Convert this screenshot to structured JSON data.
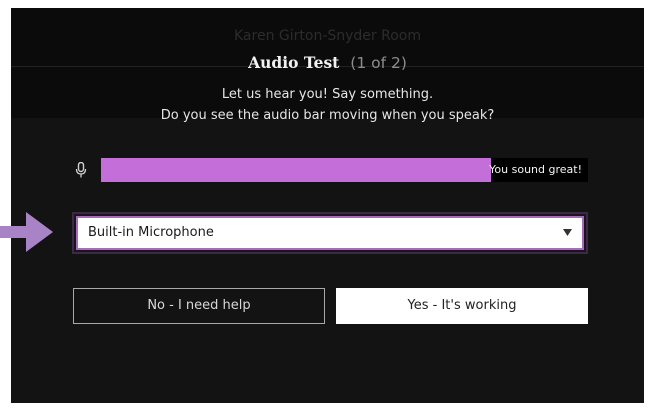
{
  "room": {
    "name": "Karen Girton-Snyder Room"
  },
  "dialog": {
    "title": "Audio Test",
    "step": "(1 of 2)",
    "instruction_1": "Let us hear you! Say something.",
    "instruction_2": "Do you see the audio bar moving when you speak?"
  },
  "audio_meter": {
    "icon": "microphone-icon",
    "level_percent": 80,
    "status_text": "You sound great!",
    "fill_color": "#c46fd9"
  },
  "mic_select": {
    "selected": "Built-in Microphone"
  },
  "buttons": {
    "no_label": "No - I need help",
    "yes_label": "Yes - It's working"
  },
  "annotation": {
    "icon": "arrow-right-icon",
    "color": "#a883c6"
  }
}
